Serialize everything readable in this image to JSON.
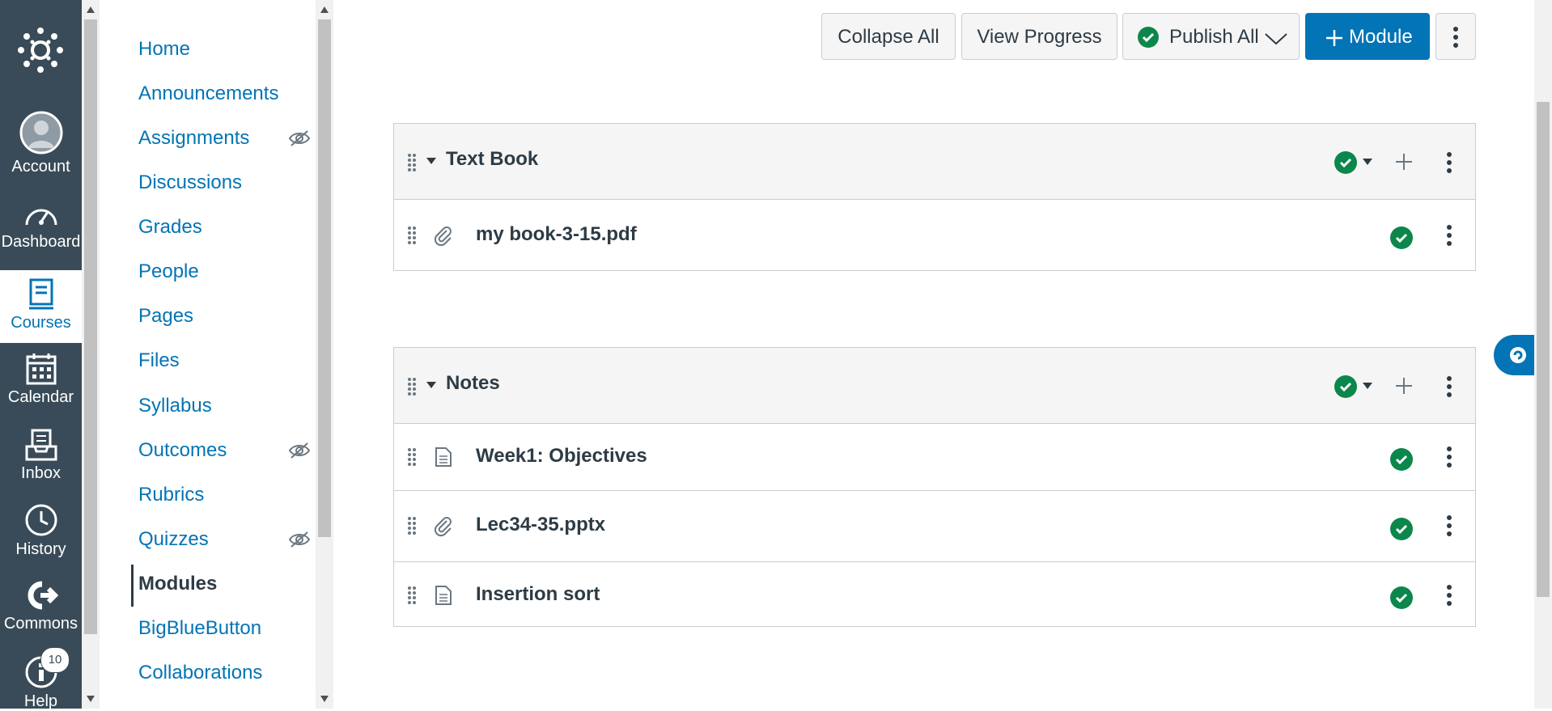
{
  "global_nav": {
    "items": [
      {
        "label": "Account",
        "icon": "account-avatar-icon"
      },
      {
        "label": "Dashboard",
        "icon": "dashboard-gauge-icon"
      },
      {
        "label": "Courses",
        "icon": "courses-book-icon",
        "active": true
      },
      {
        "label": "Calendar",
        "icon": "calendar-icon"
      },
      {
        "label": "Inbox",
        "icon": "inbox-icon"
      },
      {
        "label": "History",
        "icon": "history-clock-icon"
      },
      {
        "label": "Commons",
        "icon": "commons-icon"
      },
      {
        "label": "Help",
        "icon": "help-icon",
        "badge": "10"
      }
    ]
  },
  "course_nav": {
    "items": [
      {
        "label": "Home"
      },
      {
        "label": "Announcements"
      },
      {
        "label": "Assignments",
        "hidden_icon": true
      },
      {
        "label": "Discussions"
      },
      {
        "label": "Grades"
      },
      {
        "label": "People"
      },
      {
        "label": "Pages"
      },
      {
        "label": "Files"
      },
      {
        "label": "Syllabus"
      },
      {
        "label": "Outcomes",
        "hidden_icon": true
      },
      {
        "label": "Rubrics"
      },
      {
        "label": "Quizzes",
        "hidden_icon": true
      },
      {
        "label": "Modules",
        "active": true
      },
      {
        "label": "BigBlueButton"
      },
      {
        "label": "Collaborations"
      }
    ]
  },
  "toolbar": {
    "collapse_all": "Collapse All",
    "view_progress": "View Progress",
    "publish_all": "Publish All",
    "add_module": "Module"
  },
  "modules": [
    {
      "title": "Text Book",
      "items": [
        {
          "title": "my book-3-15.pdf",
          "type": "attachment"
        }
      ]
    },
    {
      "title": "Notes",
      "items": [
        {
          "title": "Week1: Objectives",
          "type": "page"
        },
        {
          "title": "Lec34-35.pptx",
          "type": "attachment"
        },
        {
          "title": "Insertion sort",
          "type": "page"
        }
      ]
    }
  ],
  "colors": {
    "nav_bg": "#394b58",
    "link": "#0374b5",
    "published": "#0b874b",
    "module_header_bg": "#f5f5f5"
  }
}
